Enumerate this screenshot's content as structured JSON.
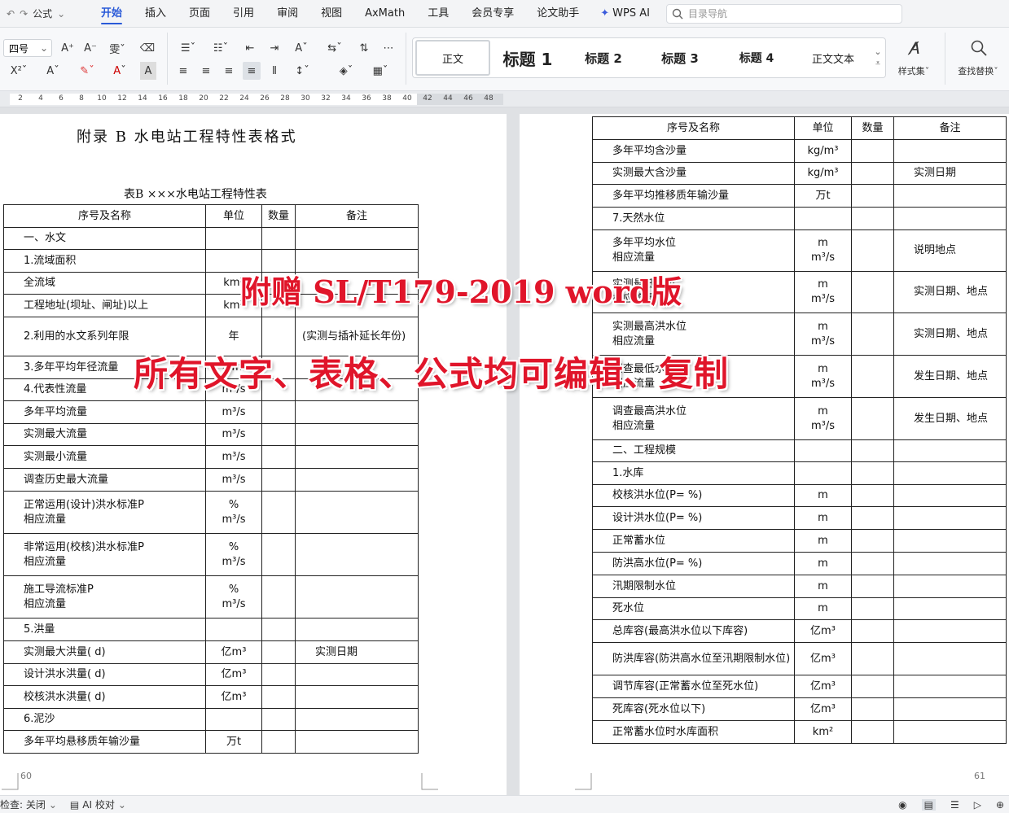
{
  "menubar": {
    "qa_label": "公式",
    "tabs": [
      "开始",
      "插入",
      "页面",
      "引用",
      "审阅",
      "视图",
      "AxMath",
      "工具",
      "会员专享",
      "论文助手"
    ],
    "active_tab": "开始",
    "wps_ai": "WPS AI",
    "nav_placeholder": "目录导航"
  },
  "ribbon": {
    "font_size": "四号",
    "styles": [
      "正文",
      "标题 1",
      "标题 2",
      "标题 3",
      "标题 4",
      "正文文本"
    ],
    "style_gallery": "样式集",
    "find_replace": "查找替换"
  },
  "ruler": {
    "ticks": [
      "2",
      "4",
      "6",
      "8",
      "10",
      "12",
      "14",
      "16",
      "18",
      "20",
      "22",
      "24",
      "26",
      "28",
      "30",
      "32",
      "34",
      "36",
      "38",
      "40",
      "42",
      "44",
      "46",
      "48"
    ]
  },
  "left_page": {
    "title": "附录 B  水电站工程特性表格式",
    "subtitle": "表B  ×××水电站工程特性表",
    "header": [
      "序号及名称",
      "单位",
      "数量",
      "备注"
    ],
    "rows": [
      {
        "name": "一、水文",
        "unit": "",
        "note": ""
      },
      {
        "name": "1.流域面积",
        "unit": "",
        "note": ""
      },
      {
        "name": "全流域",
        "unit": "km²",
        "note": ""
      },
      {
        "name": "工程地址(坝址、闸址)以上",
        "unit": "km²",
        "note": ""
      },
      {
        "name": "2.利用的水文系列年限",
        "unit": "年",
        "note": "(实测与插补延长年份)"
      },
      {
        "name": "3.多年平均年径流量",
        "unit": "亿m³",
        "note": ""
      },
      {
        "name": "4.代表性流量",
        "unit": "m³/s",
        "note": ""
      },
      {
        "name": "多年平均流量",
        "unit": "m³/s",
        "note": ""
      },
      {
        "name": "实测最大流量",
        "unit": "m³/s",
        "note": ""
      },
      {
        "name": "实测最小流量",
        "unit": "m³/s",
        "note": ""
      },
      {
        "name": "调查历史最大流量",
        "unit": "m³/s",
        "note": ""
      },
      {
        "name": "正常运用(设计)洪水标准P\n相应流量",
        "unit": "%\nm³/s",
        "note": ""
      },
      {
        "name": "非常运用(校核)洪水标准P\n相应流量",
        "unit": "%\nm³/s",
        "note": ""
      },
      {
        "name": "施工导流标准P\n相应流量",
        "unit": "%\nm³/s",
        "note": ""
      },
      {
        "name": "5.洪量",
        "unit": "",
        "note": ""
      },
      {
        "name": "实测最大洪量(   d)",
        "unit": "亿m³",
        "note": "实测日期"
      },
      {
        "name": "设计洪水洪量(   d)",
        "unit": "亿m³",
        "note": ""
      },
      {
        "name": "校核洪水洪量(   d)",
        "unit": "亿m³",
        "note": ""
      },
      {
        "name": "6.泥沙",
        "unit": "",
        "note": ""
      },
      {
        "name": "多年平均悬移质年输沙量",
        "unit": "万t",
        "note": ""
      }
    ],
    "page_number": "60"
  },
  "right_page": {
    "header": [
      "序号及名称",
      "单位",
      "数量",
      "备注"
    ],
    "rows": [
      {
        "name": "多年平均含沙量",
        "unit": "kg/m³",
        "note": ""
      },
      {
        "name": "实测最大含沙量",
        "unit": "kg/m³",
        "note": "实测日期"
      },
      {
        "name": "多年平均推移质年输沙量",
        "unit": "万t",
        "note": ""
      },
      {
        "name": "7.天然水位",
        "unit": "",
        "note": ""
      },
      {
        "name": "多年平均水位\n相应流量",
        "unit": "m\nm³/s",
        "note": "说明地点"
      },
      {
        "name": "实测最低水位\n相应流量",
        "unit": "m\nm³/s",
        "note": "实测日期、地点"
      },
      {
        "name": "实测最高洪水位\n相应流量",
        "unit": "m\nm³/s",
        "note": "实测日期、地点"
      },
      {
        "name": "调查最低水位\n相应流量",
        "unit": "m\nm³/s",
        "note": "发生日期、地点"
      },
      {
        "name": "调查最高洪水位\n相应流量",
        "unit": "m\nm³/s",
        "note": "发生日期、地点"
      },
      {
        "name": "二、工程规模",
        "unit": "",
        "note": ""
      },
      {
        "name": "1.水库",
        "unit": "",
        "note": ""
      },
      {
        "name": "校核洪水位(P=    %)",
        "unit": "m",
        "note": ""
      },
      {
        "name": "设计洪水位(P=    %)",
        "unit": "m",
        "note": ""
      },
      {
        "name": "正常蓄水位",
        "unit": "m",
        "note": ""
      },
      {
        "name": "防洪高水位(P=    %)",
        "unit": "m",
        "note": ""
      },
      {
        "name": "汛期限制水位",
        "unit": "m",
        "note": ""
      },
      {
        "name": "死水位",
        "unit": "m",
        "note": ""
      },
      {
        "name": "总库容(最高洪水位以下库容)",
        "unit": "亿m³",
        "note": ""
      },
      {
        "name": "防洪库容(防洪高水位至汛期限制水位)",
        "unit": "亿m³",
        "note": ""
      },
      {
        "name": "调节库容(正常蓄水位至死水位)",
        "unit": "亿m³",
        "note": ""
      },
      {
        "name": "死库容(死水位以下)",
        "unit": "亿m³",
        "note": ""
      },
      {
        "name": "正常蓄水位时水库面积",
        "unit": "km²",
        "note": ""
      }
    ],
    "page_number": "61"
  },
  "overlay": {
    "line1": "附赠 SL/T179-2019 word版",
    "line2": "所有文字、表格、公式均可编辑、复制"
  },
  "statusbar": {
    "check_label": "检查: 关闭",
    "ai_check": "AI 校对"
  }
}
